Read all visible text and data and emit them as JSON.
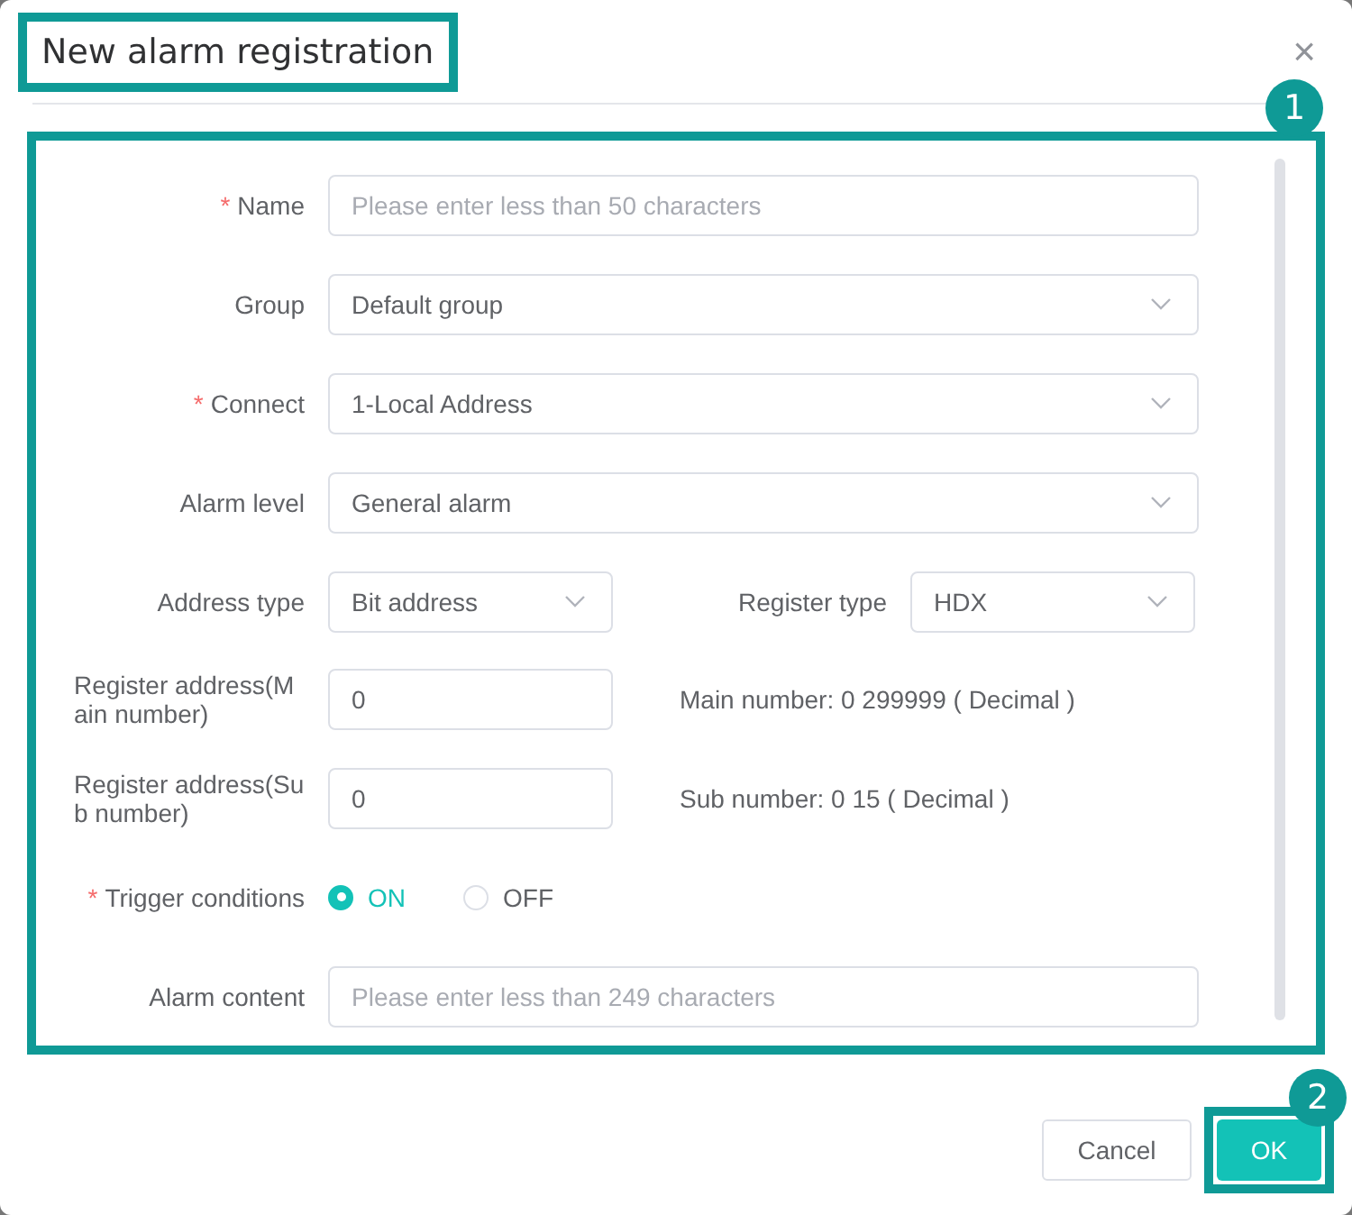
{
  "dialog": {
    "title": "New alarm registration",
    "close": "×"
  },
  "callouts": [
    "1",
    "2"
  ],
  "form": {
    "rows": [
      {
        "kind": "text",
        "label": "Name",
        "mark": "*",
        "placeholder": "Please enter less than 50 characters"
      },
      {
        "kind": "select",
        "label": "Group",
        "value": "Default group"
      },
      {
        "kind": "select",
        "label": "Connect",
        "mark": "*",
        "value": "1-Local Address"
      },
      {
        "kind": "select",
        "label": "Alarm level",
        "value": "General alarm"
      },
      {
        "kind": "pair",
        "left": {
          "label": "Address type",
          "value": "Bit address"
        },
        "right": {
          "label": "Register type",
          "value": "HDX"
        }
      },
      {
        "kind": "number",
        "label": "Register address(Main number)",
        "value": "0",
        "hint": "Main number: 0 299999 ( Decimal )"
      },
      {
        "kind": "number",
        "label": "Register address(Sub number)",
        "value": "0",
        "hint": "Sub number: 0 15 ( Decimal )"
      },
      {
        "kind": "radio",
        "label": "Trigger conditions",
        "mark": "*",
        "options": [
          {
            "label": "ON",
            "selected": true
          },
          {
            "label": "OFF",
            "selected": false
          }
        ]
      },
      {
        "kind": "text",
        "label": "Alarm content",
        "placeholder": "Please enter less than 249 characters"
      }
    ]
  },
  "buttons": [
    {
      "label": "Cancel",
      "kind": "secondary"
    },
    {
      "label": "OK",
      "kind": "primary"
    }
  ]
}
